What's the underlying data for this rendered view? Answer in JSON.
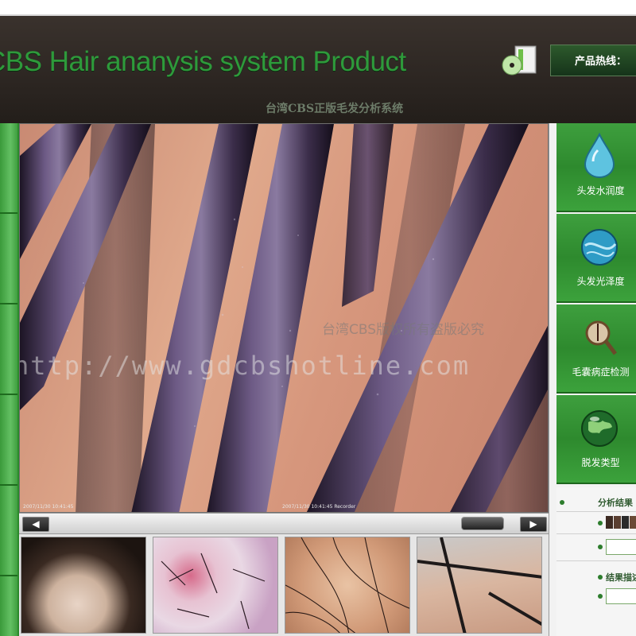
{
  "header": {
    "title": "CBS Hair ananysis system Product",
    "subtitle": "台湾CBS正版毛发分析系统",
    "hotline_label": "产品热线："
  },
  "viewport": {
    "watermark_cn": "台湾CBS版权所有盗版必究",
    "watermark_url": "http://www.gdcbshotline.com",
    "capture_stamp": "2007/11/30 10:41:45",
    "capture_stamp2": "2007/11/30 10:41:45 Recorder"
  },
  "scrollbar": {
    "left_icon": "arrow-left-icon",
    "right_icon": "arrow-right-icon"
  },
  "features": [
    {
      "label": "头发水润度",
      "icon": "water-drop-icon"
    },
    {
      "label": "头发光泽度",
      "icon": "glossy-sphere-icon"
    },
    {
      "label": "毛囊病症检测",
      "icon": "magnifier-follicle-icon"
    },
    {
      "label": "脱发类型",
      "icon": "globe-icon"
    }
  ],
  "results": {
    "analysis_result_label": "分析结果",
    "result_description_label": "结果描述",
    "swatch_colors": [
      "#3d2a22",
      "#5a3e30",
      "#2a2a2a",
      "#6a4a36"
    ]
  },
  "colors": {
    "accent_green": "#2e8a2e",
    "title_green": "#2e9a3b",
    "header_bg": "#2a2420"
  }
}
